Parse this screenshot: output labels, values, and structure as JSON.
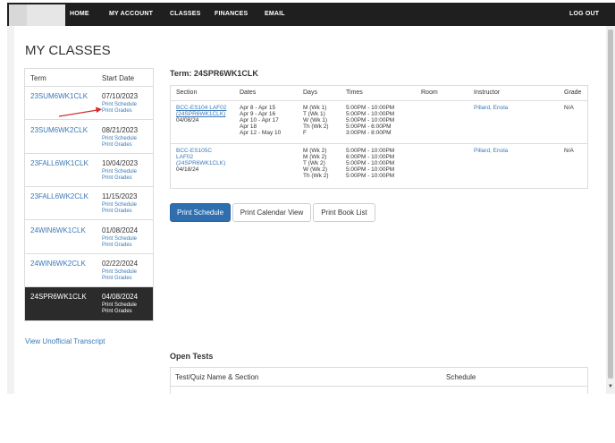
{
  "nav": {
    "items": [
      "HOME",
      "MY ACCOUNT",
      "CLASSES",
      "FINANCES",
      "EMAIL"
    ],
    "logout": "LOG OUT"
  },
  "page": {
    "title": "MY CLASSES"
  },
  "terms": {
    "headers": {
      "term": "Term",
      "start": "Start Date"
    },
    "print_schedule": "Print Schedule",
    "print_grades": "Print Grades",
    "rows": [
      {
        "code": "23SUM6WK1CLK",
        "date": "07/10/2023"
      },
      {
        "code": "23SUM6WK2CLK",
        "date": "08/21/2023"
      },
      {
        "code": "23FALL6WK1CLK",
        "date": "10/04/2023"
      },
      {
        "code": "23FALL6WK2CLK",
        "date": "11/15/2023"
      },
      {
        "code": "24WIN6WK1CLK",
        "date": "01/08/2024"
      },
      {
        "code": "24WIN6WK2CLK",
        "date": "02/22/2024"
      },
      {
        "code": "24SPR6WK1CLK",
        "date": "04/08/2024",
        "active": true
      }
    ]
  },
  "transcript_link": "View Unofficial Transcript",
  "schedule": {
    "heading": "Term: 24SPR6WK1CLK",
    "headers": [
      "Section",
      "Dates",
      "Days",
      "Times",
      "Room",
      "Instructor",
      "Grade"
    ],
    "rows": [
      {
        "section": [
          "BCC-ES104 LAF02",
          "(24SPR6WK1CLK)",
          "04/08/24"
        ],
        "dates": [
          "Apr 8 - Apr 15",
          "Apr 9 - Apr 16",
          "Apr 10 - Apr 17",
          "Apr 18",
          "Apr 12 - May 10"
        ],
        "days": [
          "M (Wk 1)",
          "T (Wk 1)",
          "W (Wk 1)",
          "Th (Wk 2)",
          "F"
        ],
        "times": [
          "5:00PM - 10:00PM",
          "5:00PM - 10:00PM",
          "5:00PM - 10:00PM",
          "5:00PM - 6:00PM",
          "3:00PM - 8:00PM"
        ],
        "room": "",
        "instructor": "Pillard, Enola",
        "grade": "N/A"
      },
      {
        "section": [
          "BCC-ES105C",
          "LAF02",
          "(24SPR6WK1CLK)",
          "04/18/24"
        ],
        "dates": [],
        "days": [
          "M (Wk 2)",
          "M (Wk 2)",
          "T (Wk 2)",
          "W (Wk 2)",
          "Th (Wk 2)"
        ],
        "times": [
          "5:00PM - 10:00PM",
          "6:00PM - 10:00PM",
          "5:00PM - 10:00PM",
          "5:00PM - 10:00PM",
          "5:00PM - 10:00PM"
        ],
        "room": "",
        "instructor": "Pillard, Enola",
        "grade": "N/A"
      }
    ]
  },
  "buttons": {
    "print_schedule": "Print Schedule",
    "print_calendar": "Print Calendar View",
    "print_booklist": "Print Book List"
  },
  "open_tests": {
    "heading": "Open Tests",
    "headers": {
      "name": "Test/Quiz Name & Section",
      "schedule": "Schedule"
    }
  },
  "colors": {
    "nav_bg": "#1f1f1f",
    "link": "#3a78b8",
    "primary_button": "#2f6fb0",
    "active_row": "#2b2b2b",
    "annotation_arrow": "#d42a2a"
  }
}
